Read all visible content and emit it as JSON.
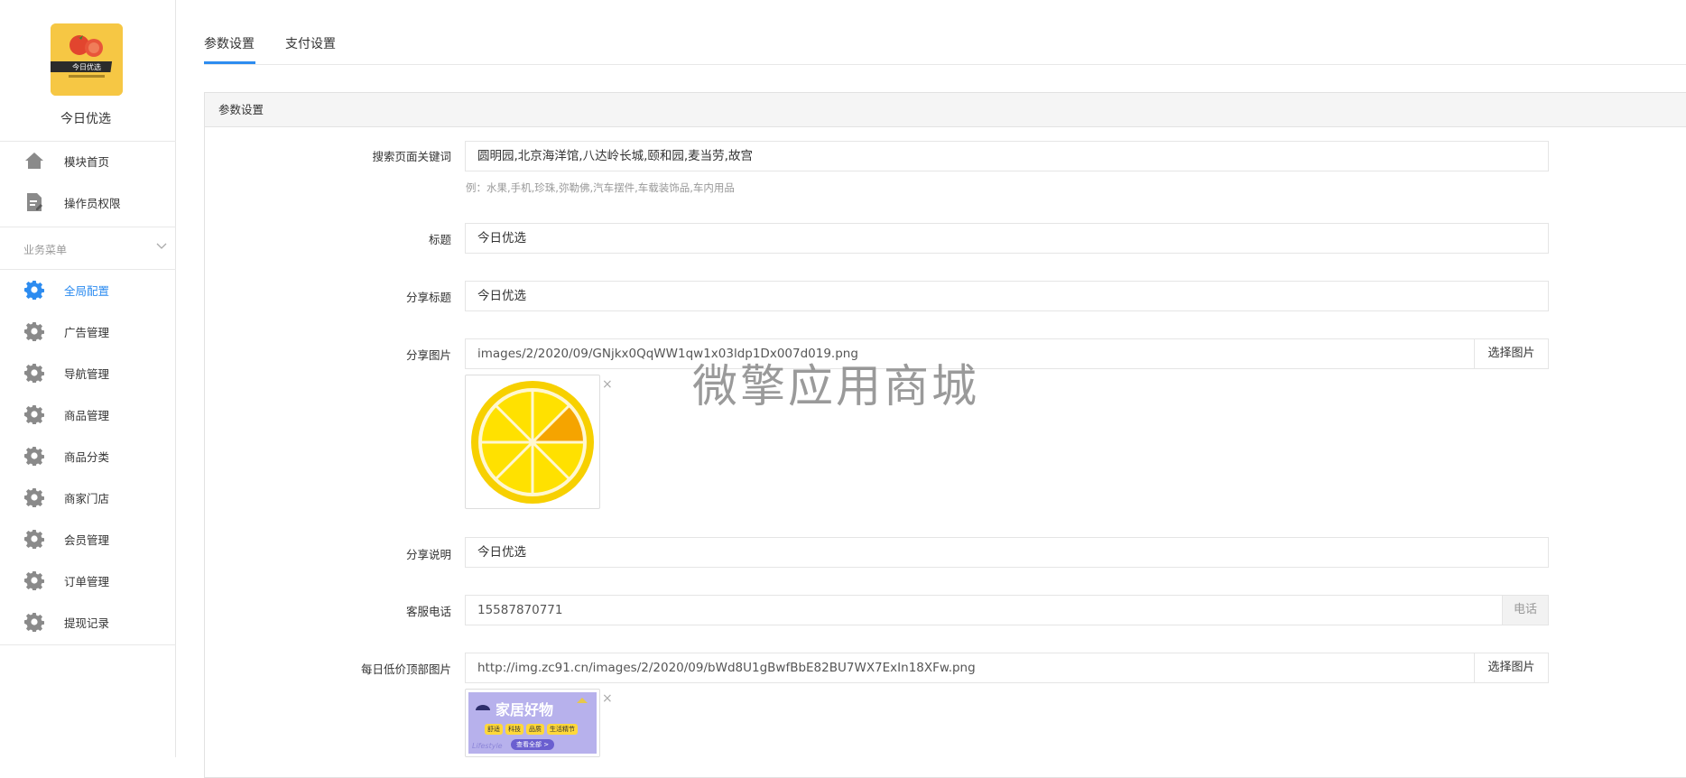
{
  "sidebar": {
    "logo_text": "今日优选",
    "shop_name": "今日优选",
    "top_items": [
      {
        "label": "模块首页",
        "icon": "home-icon"
      },
      {
        "label": "操作员权限",
        "icon": "document-edit-icon"
      }
    ],
    "group_title": "业务菜单",
    "items": [
      {
        "label": "全局配置",
        "icon": "gear-icon",
        "active": true
      },
      {
        "label": "广告管理",
        "icon": "gear-icon"
      },
      {
        "label": "导航管理",
        "icon": "gear-icon"
      },
      {
        "label": "商品管理",
        "icon": "gear-icon"
      },
      {
        "label": "商品分类",
        "icon": "gear-icon"
      },
      {
        "label": "商家门店",
        "icon": "gear-icon"
      },
      {
        "label": "会员管理",
        "icon": "gear-icon"
      },
      {
        "label": "订单管理",
        "icon": "gear-icon"
      },
      {
        "label": "提现记录",
        "icon": "gear-icon"
      }
    ],
    "active_color": "#2d8cf0"
  },
  "tabs": [
    {
      "label": "参数设置",
      "active": true
    },
    {
      "label": "支付设置",
      "active": false
    }
  ],
  "panel": {
    "title": "参数设置",
    "fields": {
      "search_keywords": {
        "label": "搜索页面关键词",
        "value": "圆明园,北京海洋馆,八达岭长城,颐和园,麦当劳,故宫",
        "help": "例：水果,手机,珍珠,弥勒佛,汽车摆件,车载装饰品,车内用品"
      },
      "title": {
        "label": "标题",
        "value": "今日优选"
      },
      "share_title": {
        "label": "分享标题",
        "value": "今日优选"
      },
      "share_image": {
        "label": "分享图片",
        "value": "images/2/2020/09/GNjkx0QqWW1qw1x03ldp1Dx007d019.png",
        "button": "选择图片"
      },
      "share_desc": {
        "label": "分享说明",
        "value": "今日优选"
      },
      "service_phone": {
        "label": "客服电话",
        "value": "15587870771",
        "addon": "电话"
      },
      "daily_banner": {
        "label": "每日低价顶部图片",
        "value": "http://img.zc91.cn/images/2/2020/09/bWd8U1gBwfBbE82BU7WX7ExIn18XFw.png",
        "button": "选择图片",
        "banner_title": "家居好物",
        "banner_tags": [
          "舒适",
          "科技",
          "品质",
          "生活精节"
        ],
        "banner_button": "查看全部 >",
        "banner_corner": "Lifestyle"
      }
    },
    "close_glyph": "×"
  },
  "watermark": "微擎应用商城"
}
